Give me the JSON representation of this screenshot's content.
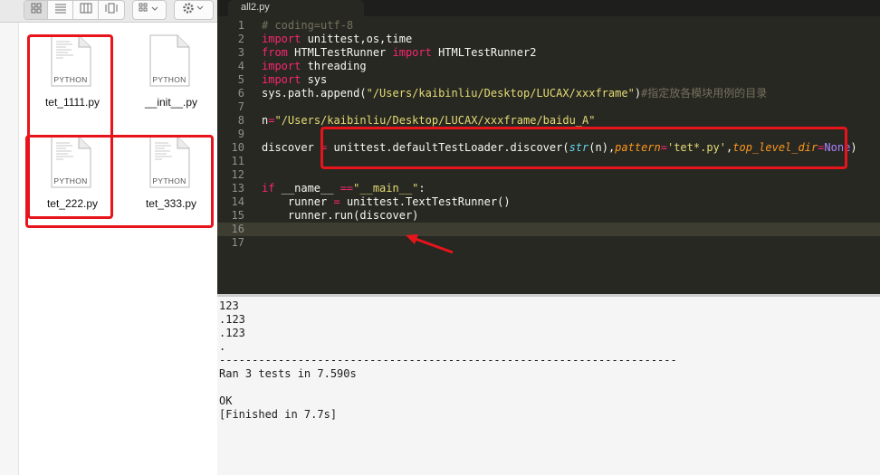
{
  "editor": {
    "tab_title": "all2.py",
    "lines": [
      {
        "n": "1",
        "parts": [
          {
            "t": "# coding=utf-8",
            "c": "comment"
          }
        ]
      },
      {
        "n": "2",
        "parts": [
          {
            "t": "import",
            "c": "kw"
          },
          {
            "t": " unittest,os,time",
            "c": ""
          }
        ]
      },
      {
        "n": "3",
        "parts": [
          {
            "t": "from",
            "c": "kw"
          },
          {
            "t": " HTMLTestRunner ",
            "c": ""
          },
          {
            "t": "import",
            "c": "kw"
          },
          {
            "t": " HTMLTestRunner2",
            "c": ""
          }
        ]
      },
      {
        "n": "4",
        "parts": [
          {
            "t": "import",
            "c": "kw"
          },
          {
            "t": " threading",
            "c": ""
          }
        ]
      },
      {
        "n": "5",
        "parts": [
          {
            "t": "import",
            "c": "kw"
          },
          {
            "t": " sys",
            "c": ""
          }
        ]
      },
      {
        "n": "6",
        "parts": [
          {
            "t": "sys.path.append(",
            "c": ""
          },
          {
            "t": "\"/Users/kaibinliu/Desktop/LUCAX/xxxframe\"",
            "c": "str"
          },
          {
            "t": ")",
            "c": ""
          },
          {
            "t": "#指定放各模块用例的目录",
            "c": "comment"
          }
        ]
      },
      {
        "n": "7",
        "parts": []
      },
      {
        "n": "8",
        "parts": [
          {
            "t": "n",
            "c": ""
          },
          {
            "t": "=",
            "c": "op"
          },
          {
            "t": "\"/Users/kaibinliu/Desktop/LUCAX/xxxframe/baidu_A\"",
            "c": "str"
          }
        ]
      },
      {
        "n": "9",
        "parts": []
      },
      {
        "n": "10",
        "parts": [
          {
            "t": "discover ",
            "c": ""
          },
          {
            "t": "=",
            "c": "op"
          },
          {
            "t": " unittest.defaultTestLoader.discover(",
            "c": ""
          },
          {
            "t": "str",
            "c": "builtin"
          },
          {
            "t": "(n),",
            "c": ""
          },
          {
            "t": "pattern",
            "c": "param"
          },
          {
            "t": "=",
            "c": "op"
          },
          {
            "t": "'tet*.py'",
            "c": "str"
          },
          {
            "t": ",",
            "c": ""
          },
          {
            "t": "top_level_dir",
            "c": "param"
          },
          {
            "t": "=",
            "c": "op"
          },
          {
            "t": "None",
            "c": "const"
          },
          {
            "t": ")",
            "c": ""
          }
        ]
      },
      {
        "n": "11",
        "parts": []
      },
      {
        "n": "12",
        "parts": []
      },
      {
        "n": "13",
        "parts": [
          {
            "t": "if",
            "c": "kw"
          },
          {
            "t": " __name__ ",
            "c": ""
          },
          {
            "t": "==",
            "c": "op"
          },
          {
            "t": "\"__main__\"",
            "c": "str"
          },
          {
            "t": ":",
            "c": ""
          }
        ]
      },
      {
        "n": "14",
        "parts": [
          {
            "t": "    runner ",
            "c": ""
          },
          {
            "t": "=",
            "c": "op"
          },
          {
            "t": " unittest.TextTestRunner()",
            "c": ""
          }
        ]
      },
      {
        "n": "15",
        "parts": [
          {
            "t": "    runner.run(discover)",
            "c": ""
          }
        ]
      },
      {
        "n": "16",
        "parts": [],
        "active": true
      },
      {
        "n": "17",
        "parts": []
      }
    ]
  },
  "output": {
    "lines": [
      "123",
      ".123",
      ".123",
      ".",
      "----------------------------------------------------------------------",
      "Ran 3 tests in 7.590s",
      "",
      "OK",
      "[Finished in 7.7s]"
    ]
  },
  "finder": {
    "file_kind_label": "PYTHON",
    "files": [
      {
        "name": "tet_1111.py"
      },
      {
        "name": "__init__.py"
      },
      {
        "name": "tet_222.py"
      },
      {
        "name": "tet_333.py"
      }
    ]
  },
  "colors": {
    "annotation_red": "#e8141b",
    "editor_bg": "#272822",
    "output_bg": "#f5f5f5"
  },
  "icons": [
    "icon-view-icon",
    "list-view-icon",
    "column-view-icon",
    "coverflow-view-icon",
    "arrange-icon",
    "gear-icon",
    "python-file-icon",
    "annotation-arrow-icon"
  ]
}
